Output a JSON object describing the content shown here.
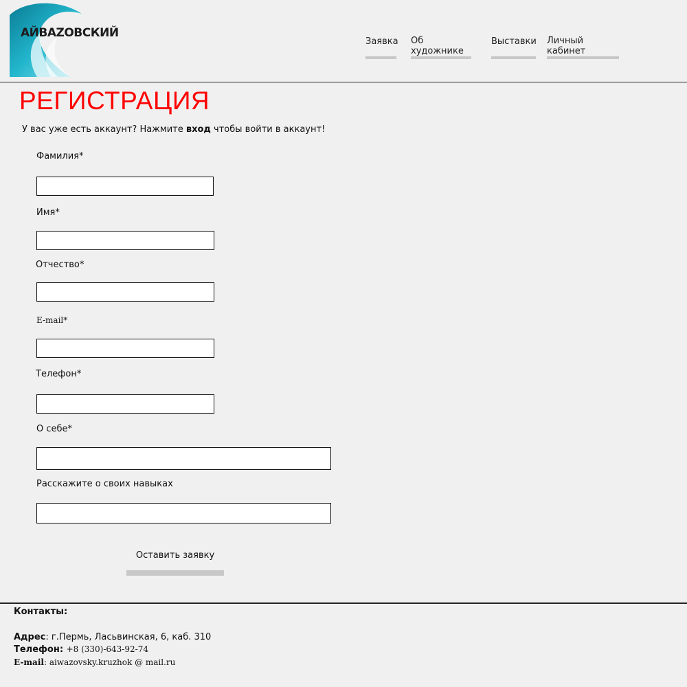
{
  "header": {
    "logo_text": "АЙВАZОВСКИЙ",
    "nav": [
      {
        "label": "Заявка"
      },
      {
        "label": "Об художнике"
      },
      {
        "label": "Выставки"
      },
      {
        "label": "Личный кабинет"
      }
    ]
  },
  "page": {
    "title": "РЕГИСТРАЦИЯ",
    "intro_before": "У вас уже есть аккаунт? Нажмите ",
    "intro_link": "вход",
    "intro_after": " чтобы войти в аккаунт!"
  },
  "form": {
    "fields": [
      {
        "label": "Фамилия*",
        "value": ""
      },
      {
        "label": "Имя*",
        "value": ""
      },
      {
        "label": "Отчество*",
        "value": ""
      },
      {
        "label": "E-mail*",
        "value": ""
      },
      {
        "label": "Телефон*",
        "value": ""
      },
      {
        "label": "О себе*",
        "value": ""
      },
      {
        "label": "Расскажите о своих навыках",
        "value": ""
      }
    ],
    "submit_label": "Оставить заявку"
  },
  "footer": {
    "contacts_heading": "Контакты:",
    "address_label": "Адрес",
    "address_value": ": г.Пермь, Ласьвинская, 6, каб. 310",
    "phone_label": "Телефон",
    "phone_value": "+8 (330)-643-92-74",
    "email_label": "E-mail",
    "email_value": "aiwazovsky.kruzhok @ mail.ru"
  },
  "colors": {
    "accent_title": "#ff0000",
    "logo_wave": "#1fb3c8",
    "nav_underline": "#c8c8c8",
    "background": "#f0f0f0"
  },
  "icons": {
    "logo": "wave-logo-icon"
  }
}
